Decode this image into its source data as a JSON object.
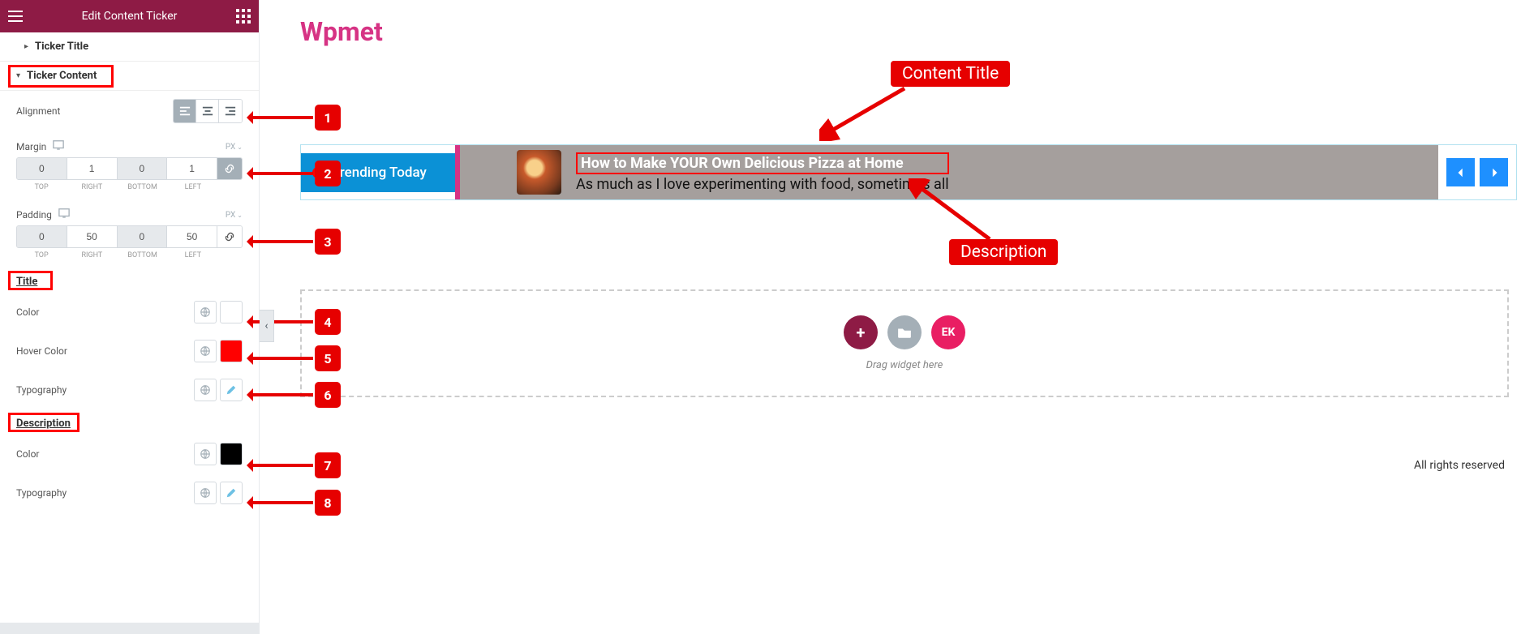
{
  "header": {
    "title": "Edit Content Ticker"
  },
  "sections": {
    "ticker_title": "Ticker Title",
    "ticker_content": "Ticker Content"
  },
  "controls": {
    "alignment": "Alignment",
    "margin": "Margin",
    "padding": "Padding",
    "title": "Title",
    "color": "Color",
    "hover_color": "Hover Color",
    "typography": "Typography",
    "description": "Description",
    "unit_px": "PX"
  },
  "margin_vals": {
    "top": "0",
    "right": "1",
    "bottom": "0",
    "left": "1"
  },
  "padding_vals": {
    "top": "0",
    "right": "50",
    "bottom": "0",
    "left": "50"
  },
  "dim_labels": {
    "t": "TOP",
    "r": "RIGHT",
    "b": "BOTTOM",
    "l": "LEFT"
  },
  "colors": {
    "title_hover": "#ff0000",
    "desc_color": "#000000"
  },
  "brand": "Wpmet",
  "ticker": {
    "label": "Trending Today",
    "title": "How to Make YOUR Own Delicious Pizza at Home",
    "desc": "As much as I love experimenting with food, sometimes all"
  },
  "dropzone": {
    "label": "Drag widget here",
    "ek": "EK"
  },
  "footer": "All rights reserved",
  "annotations": {
    "content_title": "Content Title",
    "description": "Description",
    "n1": "1",
    "n2": "2",
    "n3": "3",
    "n4": "4",
    "n5": "5",
    "n6": "6",
    "n7": "7",
    "n8": "8"
  }
}
